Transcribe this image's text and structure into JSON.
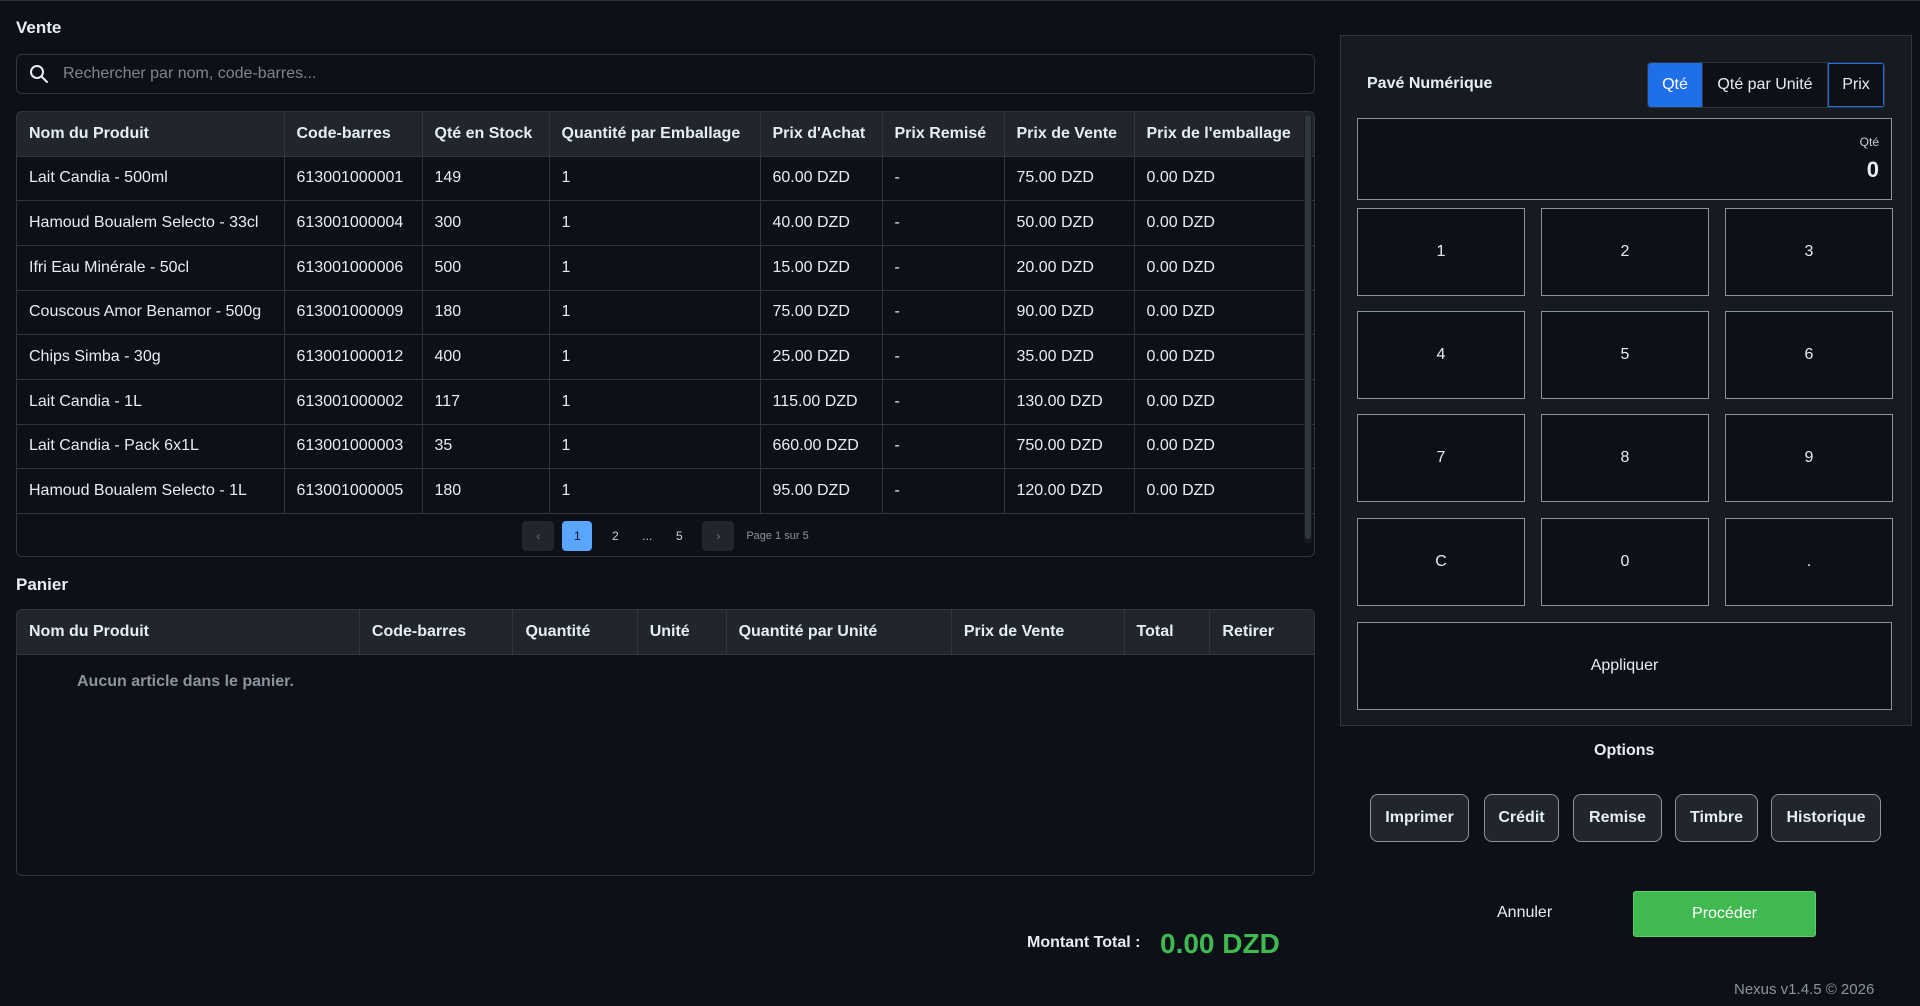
{
  "sale": {
    "title": "Vente",
    "search_placeholder": "Rechercher par nom, code-barres...",
    "columns": [
      "Nom du Produit",
      "Code-barres",
      "Qté en Stock",
      "Quantité par Emballage",
      "Prix d'Achat",
      "Prix Remisé",
      "Prix de Vente",
      "Prix de l'emballage"
    ],
    "rows": [
      [
        "Lait Candia - 500ml",
        "613001000001",
        "149",
        "1",
        "60.00 DZD",
        "-",
        "75.00 DZD",
        "0.00 DZD"
      ],
      [
        "Hamoud Boualem Selecto - 33cl",
        "613001000004",
        "300",
        "1",
        "40.00 DZD",
        "-",
        "50.00 DZD",
        "0.00 DZD"
      ],
      [
        "Ifri Eau Minérale - 50cl",
        "613001000006",
        "500",
        "1",
        "15.00 DZD",
        "-",
        "20.00 DZD",
        "0.00 DZD"
      ],
      [
        "Couscous Amor Benamor - 500g",
        "613001000009",
        "180",
        "1",
        "75.00 DZD",
        "-",
        "90.00 DZD",
        "0.00 DZD"
      ],
      [
        "Chips Simba - 30g",
        "613001000012",
        "400",
        "1",
        "25.00 DZD",
        "-",
        "35.00 DZD",
        "0.00 DZD"
      ],
      [
        "Lait Candia - 1L",
        "613001000002",
        "117",
        "1",
        "115.00 DZD",
        "-",
        "130.00 DZD",
        "0.00 DZD"
      ],
      [
        "Lait Candia - Pack 6x1L",
        "613001000003",
        "35",
        "1",
        "660.00 DZD",
        "-",
        "750.00 DZD",
        "0.00 DZD"
      ],
      [
        "Hamoud Boualem Selecto - 1L",
        "613001000005",
        "180",
        "1",
        "95.00 DZD",
        "-",
        "120.00 DZD",
        "0.00 DZD"
      ]
    ],
    "pagination": {
      "prev": "‹",
      "pages": [
        "1",
        "2",
        "...",
        "5"
      ],
      "next": "›",
      "info": "Page 1 sur 5"
    }
  },
  "cart": {
    "title": "Panier",
    "columns": [
      "Nom du Produit",
      "Code-barres",
      "Quantité",
      "Unité",
      "Quantité par Unité",
      "Prix de Vente",
      "Total",
      "Retirer"
    ],
    "empty_message": "Aucun article dans le panier."
  },
  "total": {
    "label": "Montant Total :",
    "value": "0.00 DZD"
  },
  "numpad": {
    "title": "Pavé Numérique",
    "modes": [
      "Qté",
      "Qté par Unité",
      "Prix"
    ],
    "active_mode": "Qté",
    "display_label": "Qté",
    "display_value": "0",
    "keys": [
      "1",
      "2",
      "3",
      "4",
      "5",
      "6",
      "7",
      "8",
      "9",
      "C",
      "0",
      "."
    ],
    "apply_label": "Appliquer"
  },
  "options": {
    "title": "Options",
    "buttons": [
      "Imprimer",
      "Crédit",
      "Remise",
      "Timbre",
      "Historique"
    ]
  },
  "actions": {
    "cancel": "Annuler",
    "proceed": "Procéder"
  },
  "footer": {
    "version": "Nexus v1.4.5 © 2026"
  },
  "colors": {
    "background": "#0d1117",
    "accent_blue": "#1f6feb",
    "success_green": "#3fb950"
  }
}
